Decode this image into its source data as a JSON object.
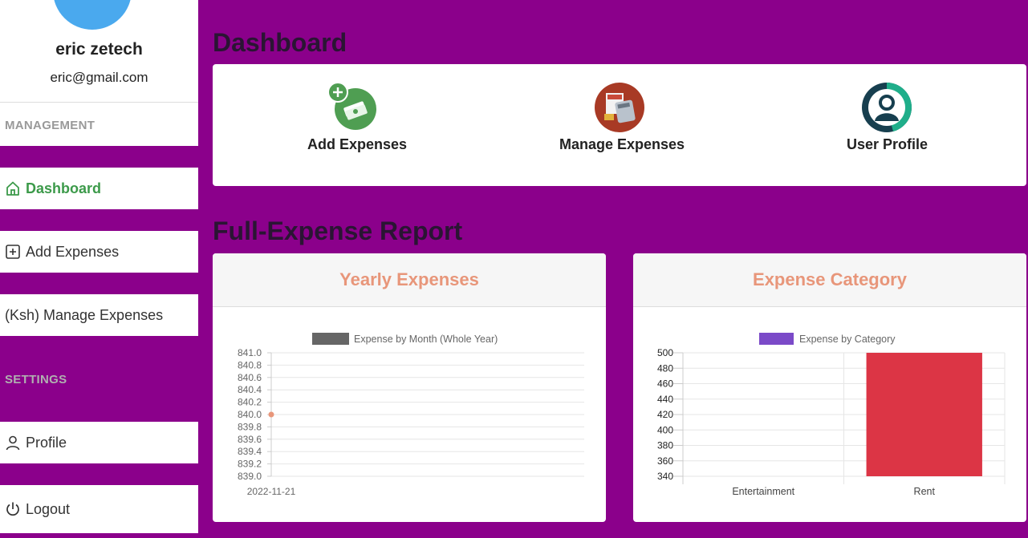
{
  "sidebar": {
    "user": {
      "name": "eric zetech",
      "email": "eric@gmail.com"
    },
    "sections": {
      "management": "MANAGEMENT",
      "settings": "SETTINGS"
    },
    "items": [
      {
        "label": "Dashboard",
        "icon": "home-icon",
        "active": true
      },
      {
        "label": "Add Expenses",
        "icon": "plus-square-icon"
      },
      {
        "label": "(Ksh) Manage Expenses",
        "icon": ""
      },
      {
        "label": "Profile",
        "icon": "person-icon"
      },
      {
        "label": "Logout",
        "icon": "power-icon"
      }
    ]
  },
  "main": {
    "dashboard_title": "Dashboard",
    "quick_actions": [
      {
        "label": "Add Expenses",
        "icon": "money-add-icon"
      },
      {
        "label": "Manage Expenses",
        "icon": "calculator-icon"
      },
      {
        "label": "User Profile",
        "icon": "user-circle-icon"
      }
    ],
    "report_title": "Full-Expense Report"
  },
  "colors": {
    "background": "#8b008b",
    "active_nav": "#3c9a4a",
    "card_title": "#e8967a",
    "bar_rent": "#dc3545",
    "legend_category": "#7b4ac8",
    "legend_month": "#666666",
    "point": "#e8967a"
  },
  "chart_data": [
    {
      "type": "line",
      "title": "Yearly Expenses",
      "series": [
        {
          "name": "Expense by Month (Whole Year)",
          "x": [
            "2022-11-21"
          ],
          "values": [
            840.0
          ]
        }
      ],
      "yticks": [
        "841.0",
        "840.8",
        "840.6",
        "840.4",
        "840.2",
        "840.0",
        "839.8",
        "839.6",
        "839.4",
        "839.2",
        "839.0"
      ],
      "ylim": [
        839.0,
        841.0
      ],
      "grid": true,
      "legend": "top"
    },
    {
      "type": "bar",
      "title": "Expense Category",
      "categories": [
        "Entertainment",
        "Rent"
      ],
      "series": [
        {
          "name": "Expense by Category",
          "values": [
            null,
            500
          ]
        }
      ],
      "yticks": [
        "500",
        "480",
        "460",
        "440",
        "420",
        "400",
        "380",
        "360",
        "340"
      ],
      "ylim": [
        340,
        500
      ],
      "grid": true,
      "legend": "top"
    }
  ]
}
